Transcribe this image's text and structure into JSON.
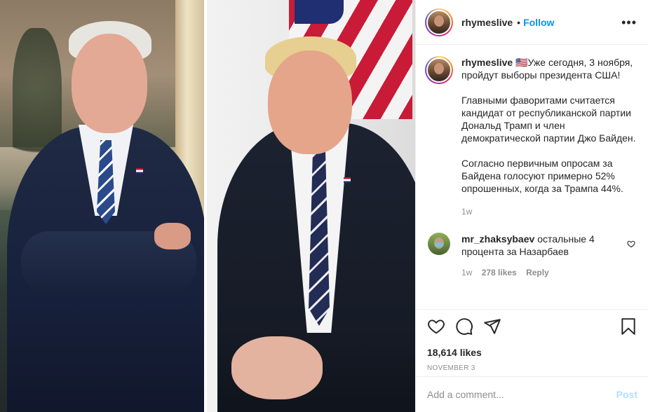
{
  "post": {
    "username": "rhymeslive",
    "follow_label": "Follow",
    "dot": "•",
    "more_label": "•••"
  },
  "caption": {
    "username": "rhymeslive",
    "text_1": "🇺🇸Уже сегодня, 3 ноября, пройдут выборы президента США!",
    "text_2": "Главными фаворитами считается кандидат от республиканской партии Дональд Трамп и член демократической партии Джо Байден.",
    "text_3": "Согласно первичным опросам за Байдена голосуют примерно 52% опрошенных, когда за Трампа 44%.",
    "time": "1w"
  },
  "comments": [
    {
      "username": "mr_zhaksybaev",
      "text": "остальные 4 процента за Назарбаев",
      "time": "1w",
      "likes": "278 likes",
      "reply_label": "Reply"
    }
  ],
  "actions": {
    "likes_count": "18,614 likes",
    "date": "NOVEMBER 3"
  },
  "add_comment": {
    "placeholder": "Add a comment...",
    "post_label": "Post"
  },
  "colors": {
    "link_blue": "#0095f6",
    "post_disabled": "#b2dffc",
    "muted": "#8e8e8e"
  },
  "icons": [
    "more-icon",
    "heart-icon",
    "comment-icon",
    "share-icon",
    "bookmark-icon",
    "small-heart-icon"
  ]
}
